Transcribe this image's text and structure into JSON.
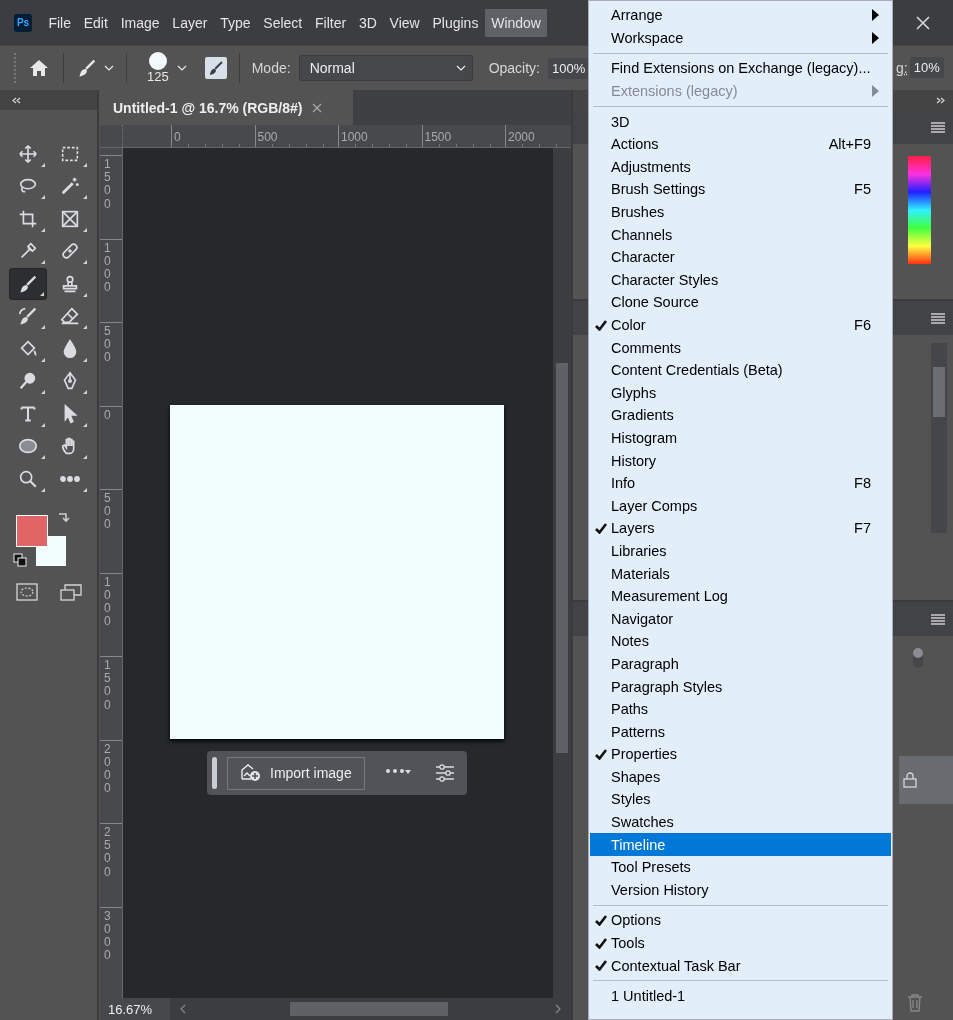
{
  "app": {
    "logo": "Ps"
  },
  "menubar": [
    {
      "label": "File",
      "selected": false
    },
    {
      "label": "Edit",
      "selected": false
    },
    {
      "label": "Image",
      "selected": false
    },
    {
      "label": "Layer",
      "selected": false
    },
    {
      "label": "Type",
      "selected": false
    },
    {
      "label": "Select",
      "selected": false
    },
    {
      "label": "Filter",
      "selected": false
    },
    {
      "label": "3D",
      "selected": false
    },
    {
      "label": "View",
      "selected": false
    },
    {
      "label": "Plugins",
      "selected": false
    },
    {
      "label": "Window",
      "selected": true
    }
  ],
  "options_bar": {
    "brush_size": "125",
    "mode_label": "Mode:",
    "mode_value": "Normal",
    "opacity_label": "Opacity:",
    "opacity_value": "100%",
    "smoothing_label": "g:",
    "smoothing_value": "10%"
  },
  "tools": [
    {
      "kind": "move",
      "selected": false
    },
    {
      "kind": "marquee",
      "selected": false
    },
    {
      "kind": "lasso",
      "selected": false
    },
    {
      "kind": "wand",
      "selected": false
    },
    {
      "kind": "crop",
      "selected": false
    },
    {
      "kind": "frame",
      "selected": false
    },
    {
      "kind": "eyedropper",
      "selected": false
    },
    {
      "kind": "healing",
      "selected": false
    },
    {
      "kind": "brush",
      "selected": true
    },
    {
      "kind": "stamp",
      "selected": false
    },
    {
      "kind": "history",
      "selected": false
    },
    {
      "kind": "eraser",
      "selected": false
    },
    {
      "kind": "bucket",
      "selected": false
    },
    {
      "kind": "drop",
      "selected": false
    },
    {
      "kind": "dodge",
      "selected": false
    },
    {
      "kind": "pen",
      "selected": false
    },
    {
      "kind": "type",
      "selected": false
    },
    {
      "kind": "arrow",
      "selected": false
    },
    {
      "kind": "ellipse",
      "selected": false
    },
    {
      "kind": "hand",
      "selected": false
    },
    {
      "kind": "zoom",
      "selected": false
    },
    {
      "kind": "more",
      "selected": false
    }
  ],
  "document": {
    "tab_title": "Untitled-1 @ 16.7% (RGB/8#)",
    "ruler_h": [
      "0",
      "500",
      "1000",
      "1500",
      "2000"
    ],
    "ruler_v": [
      "1500",
      "1000",
      "500",
      "0",
      "500",
      "1000",
      "1500",
      "2000",
      "2500",
      "3000"
    ],
    "zoom": "16.67%"
  },
  "task_bar": {
    "import_label": "Import image"
  },
  "layers_panel": {
    "toggle_on": true
  },
  "window_menu": [
    {
      "kind": "submenu",
      "label": "Arrange",
      "disabled": false
    },
    {
      "kind": "submenu",
      "label": "Workspace",
      "disabled": false
    },
    {
      "kind": "separator"
    },
    {
      "kind": "item",
      "label": "Find Extensions on Exchange (legacy)...",
      "checked": false,
      "selected": false
    },
    {
      "kind": "submenu",
      "label": "Extensions (legacy)",
      "disabled": true
    },
    {
      "kind": "separator"
    },
    {
      "kind": "item",
      "label": "3D",
      "checked": false,
      "selected": false
    },
    {
      "kind": "item",
      "label": "Actions",
      "shortcut": "Alt+F9",
      "checked": false,
      "selected": false
    },
    {
      "kind": "item",
      "label": "Adjustments",
      "checked": false,
      "selected": false
    },
    {
      "kind": "item",
      "label": "Brush Settings",
      "shortcut": "F5",
      "checked": false,
      "selected": false
    },
    {
      "kind": "item",
      "label": "Brushes",
      "checked": false,
      "selected": false
    },
    {
      "kind": "item",
      "label": "Channels",
      "checked": false,
      "selected": false
    },
    {
      "kind": "item",
      "label": "Character",
      "checked": false,
      "selected": false
    },
    {
      "kind": "item",
      "label": "Character Styles",
      "checked": false,
      "selected": false
    },
    {
      "kind": "item",
      "label": "Clone Source",
      "checked": false,
      "selected": false
    },
    {
      "kind": "item",
      "label": "Color",
      "shortcut": "F6",
      "checked": true,
      "selected": false
    },
    {
      "kind": "item",
      "label": "Comments",
      "checked": false,
      "selected": false
    },
    {
      "kind": "item",
      "label": "Content Credentials (Beta)",
      "checked": false,
      "selected": false
    },
    {
      "kind": "item",
      "label": "Glyphs",
      "checked": false,
      "selected": false
    },
    {
      "kind": "item",
      "label": "Gradients",
      "checked": false,
      "selected": false
    },
    {
      "kind": "item",
      "label": "Histogram",
      "checked": false,
      "selected": false
    },
    {
      "kind": "item",
      "label": "History",
      "checked": false,
      "selected": false
    },
    {
      "kind": "item",
      "label": "Info",
      "shortcut": "F8",
      "checked": false,
      "selected": false
    },
    {
      "kind": "item",
      "label": "Layer Comps",
      "checked": false,
      "selected": false
    },
    {
      "kind": "item",
      "label": "Layers",
      "shortcut": "F7",
      "checked": true,
      "selected": false
    },
    {
      "kind": "item",
      "label": "Libraries",
      "checked": false,
      "selected": false
    },
    {
      "kind": "item",
      "label": "Materials",
      "checked": false,
      "selected": false
    },
    {
      "kind": "item",
      "label": "Measurement Log",
      "checked": false,
      "selected": false
    },
    {
      "kind": "item",
      "label": "Navigator",
      "checked": false,
      "selected": false
    },
    {
      "kind": "item",
      "label": "Notes",
      "checked": false,
      "selected": false
    },
    {
      "kind": "item",
      "label": "Paragraph",
      "checked": false,
      "selected": false
    },
    {
      "kind": "item",
      "label": "Paragraph Styles",
      "checked": false,
      "selected": false
    },
    {
      "kind": "item",
      "label": "Paths",
      "checked": false,
      "selected": false
    },
    {
      "kind": "item",
      "label": "Patterns",
      "checked": false,
      "selected": false
    },
    {
      "kind": "item",
      "label": "Properties",
      "checked": true,
      "selected": false
    },
    {
      "kind": "item",
      "label": "Shapes",
      "checked": false,
      "selected": false
    },
    {
      "kind": "item",
      "label": "Styles",
      "checked": false,
      "selected": false
    },
    {
      "kind": "item",
      "label": "Swatches",
      "checked": false,
      "selected": false
    },
    {
      "kind": "item",
      "label": "Timeline",
      "checked": false,
      "selected": true
    },
    {
      "kind": "item",
      "label": "Tool Presets",
      "checked": false,
      "selected": false
    },
    {
      "kind": "item",
      "label": "Version History",
      "checked": false,
      "selected": false
    },
    {
      "kind": "separator"
    },
    {
      "kind": "item",
      "label": "Options",
      "checked": true,
      "selected": false
    },
    {
      "kind": "item",
      "label": "Tools",
      "checked": true,
      "selected": false
    },
    {
      "kind": "item",
      "label": "Contextual Task Bar",
      "checked": true,
      "selected": false
    },
    {
      "kind": "separator"
    },
    {
      "kind": "item",
      "label": "1 Untitled-1",
      "checked": false,
      "selected": false
    }
  ]
}
